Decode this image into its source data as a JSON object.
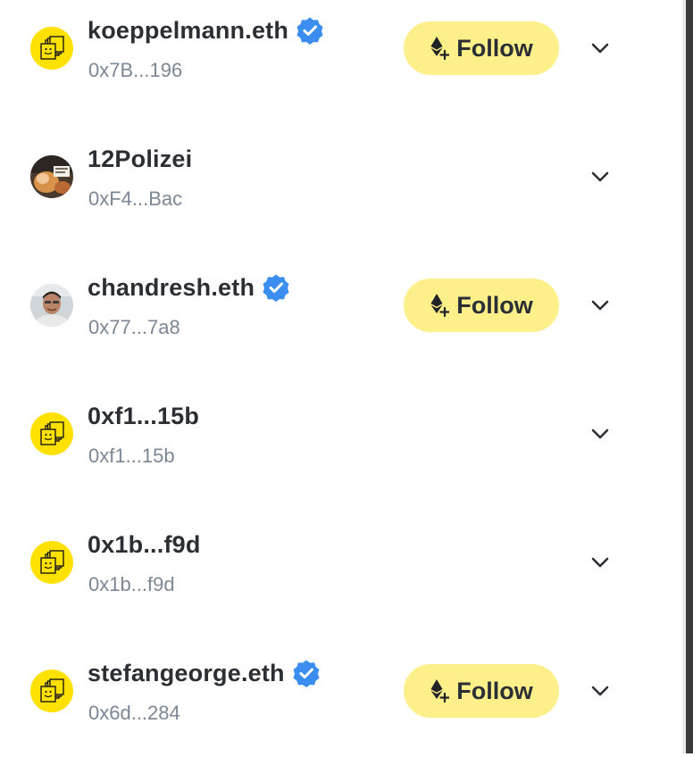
{
  "colors": {
    "follow_bg": "#fdef8a",
    "avatar_yellow": "#ffe100",
    "verified_blue": "#3b8ef0",
    "address_gray": "#7b8794",
    "name_dark": "#2b2f33"
  },
  "users": [
    {
      "name": "koeppelmann.eth",
      "address": "0x7B...196",
      "verified": true,
      "follow_label": "Follow",
      "avatar": "default-avatar-icon"
    },
    {
      "name": "12Polizei",
      "address": "0xF4...Bac",
      "verified": false,
      "follow_label": "",
      "avatar": "photo-avatar"
    },
    {
      "name": "chandresh.eth",
      "address": "0x77...7a8",
      "verified": true,
      "follow_label": "Follow",
      "avatar": "photo-avatar"
    },
    {
      "name": "0xf1...15b",
      "address": "0xf1...15b",
      "verified": false,
      "follow_label": "",
      "avatar": "default-avatar-icon"
    },
    {
      "name": "0x1b...f9d",
      "address": "0x1b...f9d",
      "verified": false,
      "follow_label": "",
      "avatar": "default-avatar-icon"
    },
    {
      "name": "stefangeorge.eth",
      "address": "0x6d...284",
      "verified": true,
      "follow_label": "Follow",
      "avatar": "default-avatar-icon"
    }
  ],
  "icons": {
    "verified": "verified-badge-icon",
    "follow": "ethereum-plus-icon",
    "expand": "chevron-down-icon"
  }
}
